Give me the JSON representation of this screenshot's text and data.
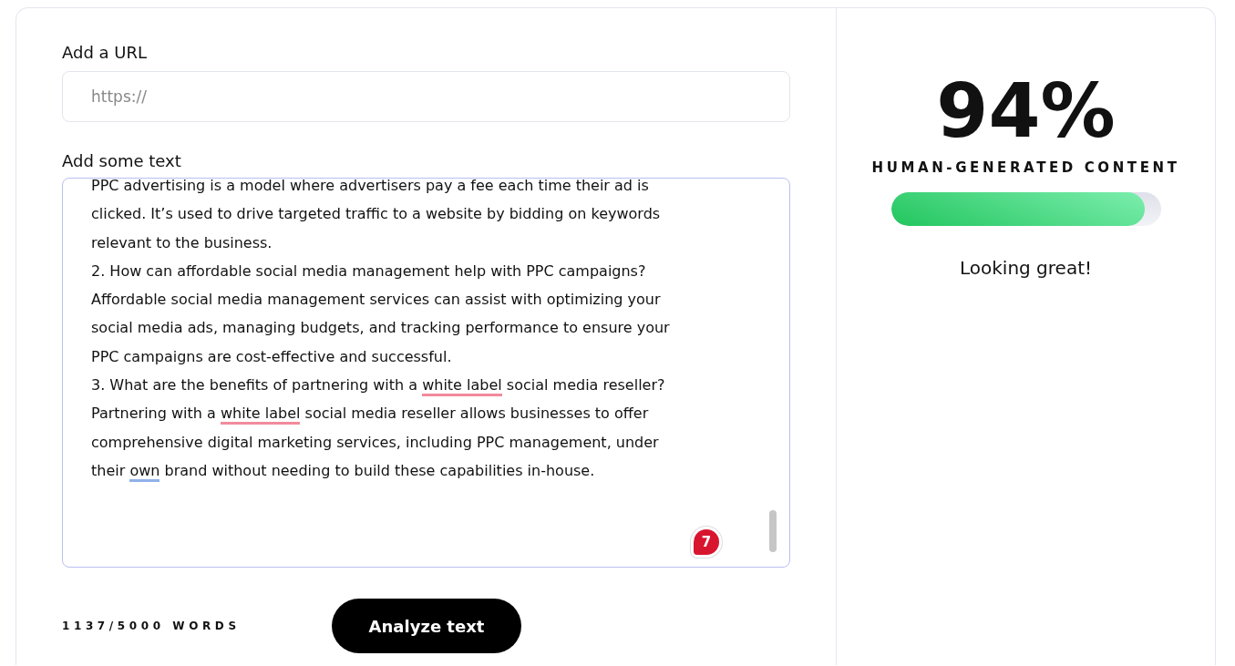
{
  "url_field": {
    "label": "Add a URL",
    "placeholder": "https://"
  },
  "text_field": {
    "label": "Add some text",
    "lines": [
      [
        {
          "text": "PPC advertising is a model where advertisers pay a fee each time their ad is"
        }
      ],
      [
        {
          "text": "clicked. It’s used to drive targeted traffic to a website by bidding on keywords"
        }
      ],
      [
        {
          "text": "relevant to the business."
        }
      ],
      [
        {
          "text": "2. How can affordable social media management help with PPC campaigns?"
        }
      ],
      [
        {
          "text": "Affordable social media management services can assist with optimizing your"
        }
      ],
      [
        {
          "text": "social media ads, managing budgets, and tracking performance to ensure your"
        }
      ],
      [
        {
          "text": "PPC campaigns are cost-effective and successful."
        }
      ],
      [
        {
          "text": "3. What are the benefits of partnering with a "
        },
        {
          "text": "white label",
          "color": "#f28b9c"
        },
        {
          "text": " social media reseller?"
        }
      ],
      [
        {
          "text": "Partnering with a "
        },
        {
          "text": "white label",
          "color": "#f28b9c"
        },
        {
          "text": " social media reseller allows businesses to offer"
        }
      ],
      [
        {
          "text": "comprehensive digital marketing services, including PPC management, under"
        }
      ],
      [
        {
          "text": "their "
        },
        {
          "text": "own",
          "color": "#8fb2e8"
        },
        {
          "text": " brand without needing to build these capabilities in-house."
        }
      ]
    ],
    "issue_badge": "7"
  },
  "word_count": "1137/5000 WORDS",
  "analyze_button": "Analyze text",
  "result": {
    "score": "94%",
    "caption": "HUMAN-GENERATED CONTENT",
    "level": 0.94,
    "verdict": "Looking great!"
  }
}
